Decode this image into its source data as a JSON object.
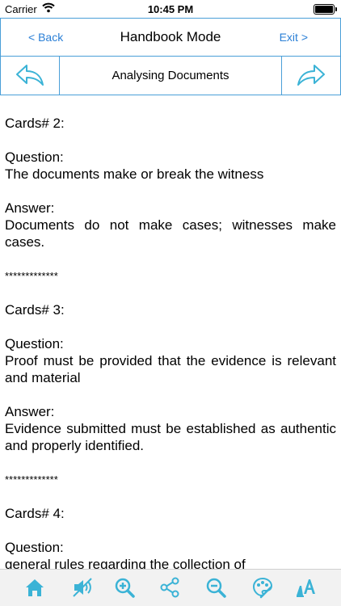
{
  "status_bar": {
    "carrier": "Carrier",
    "time": "10:45 PM"
  },
  "nav": {
    "back_label": "< Back",
    "title": "Handbook Mode",
    "exit_label": "Exit >"
  },
  "chapter": {
    "title": "Analysing Documents"
  },
  "cards": [
    {
      "header": "Cards# 2:",
      "question_label": "Question:",
      "question": "The documents make or break the witness",
      "answer_label": "Answer:",
      "answer": "Documents do not make cases; witnesses make cases.",
      "separator": "*************"
    },
    {
      "header": "Cards# 3:",
      "question_label": "Question:",
      "question": "Proof must be provided that the evidence is relevant and material",
      "answer_label": "Answer:",
      "answer": "Evidence submitted must be established as authentic and properly identified.",
      "separator": "*************"
    },
    {
      "header": "Cards# 4:",
      "question_label": "Question:",
      "question": "general rules regarding the collection of"
    }
  ],
  "toolbar": {
    "accent": "#3bb3d6",
    "icons": [
      "home-icon",
      "speaker-off-icon",
      "zoom-in-icon",
      "share-icon",
      "zoom-out-icon",
      "palette-icon",
      "font-style-icon"
    ]
  }
}
